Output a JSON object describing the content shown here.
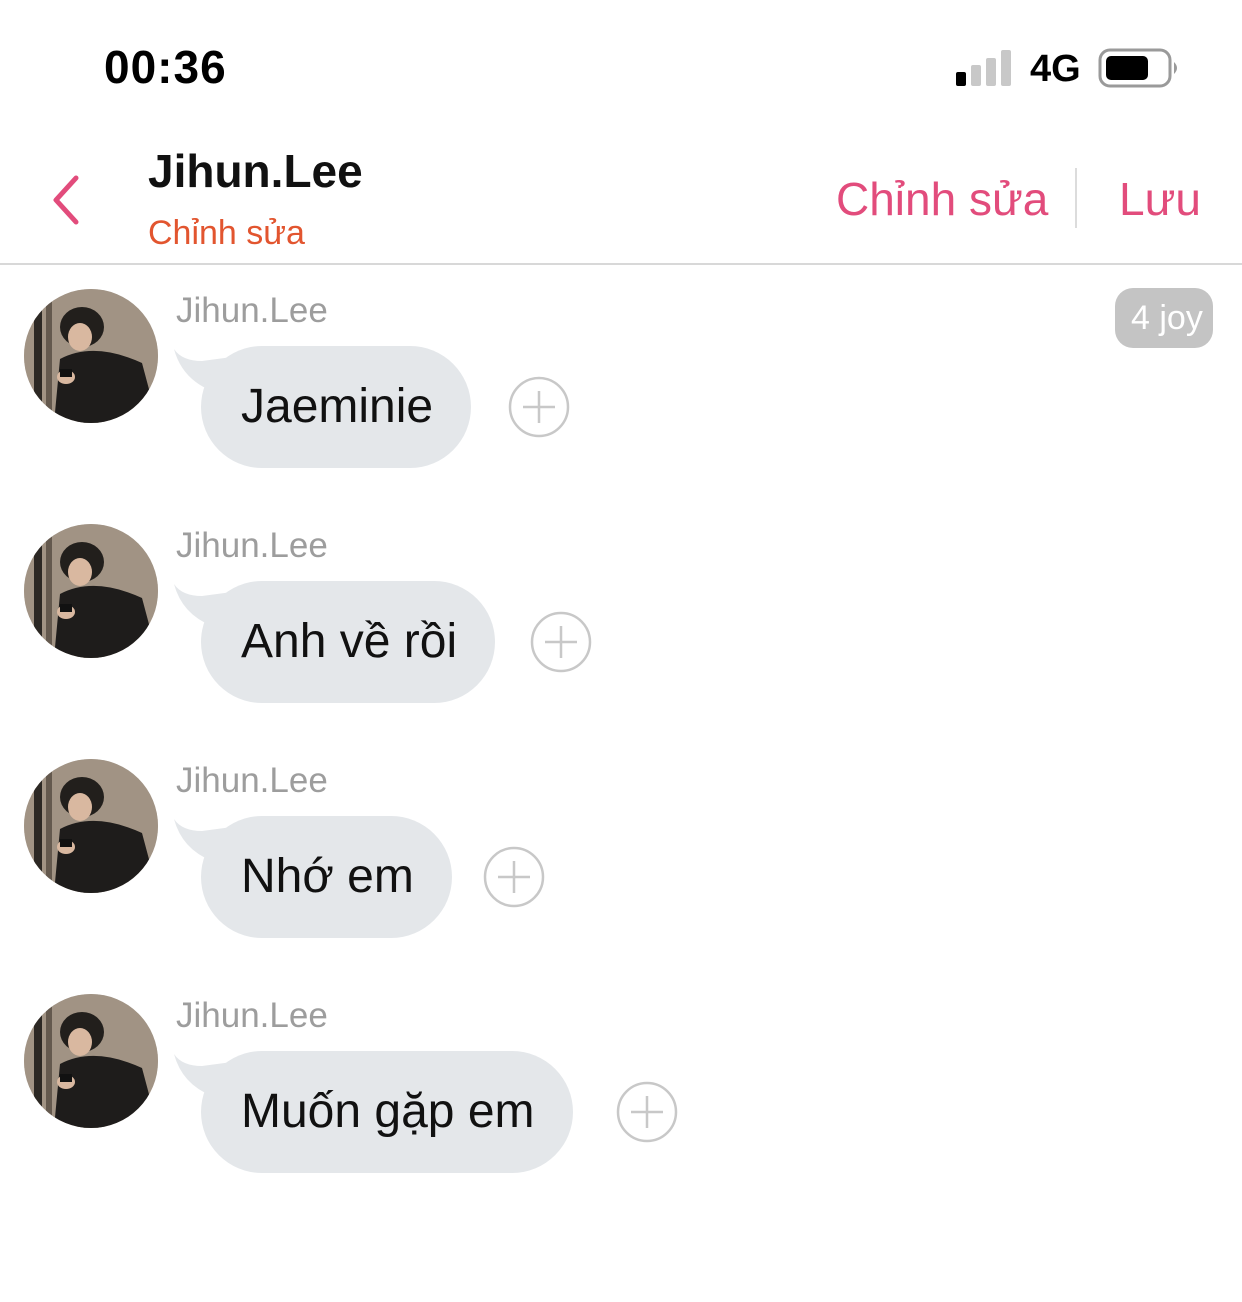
{
  "status_bar": {
    "time": "00:36",
    "network": "4G",
    "signal_icon": "signal-strength-icon",
    "battery_icon": "battery-icon"
  },
  "header": {
    "back_icon": "chevron-left-icon",
    "title": "Jihun.Lee",
    "subtitle": "Chỉnh sửa",
    "edit_label": "Chỉnh sửa",
    "save_label": "Lưu",
    "accent_color": "#e24c7c",
    "subtitle_color": "#e2552f"
  },
  "messages": [
    {
      "sender": "Jihun.Lee",
      "text": "Jaeminie",
      "time_badge": "4 joy"
    },
    {
      "sender": "Jihun.Lee",
      "text": "Anh về rồi"
    },
    {
      "sender": "Jihun.Lee",
      "text": "Nhớ em"
    },
    {
      "sender": "Jihun.Lee",
      "text": "Muốn gặp em"
    }
  ],
  "bubble_color": "#e4e7ea",
  "add_reaction_icon": "plus-circle-icon"
}
